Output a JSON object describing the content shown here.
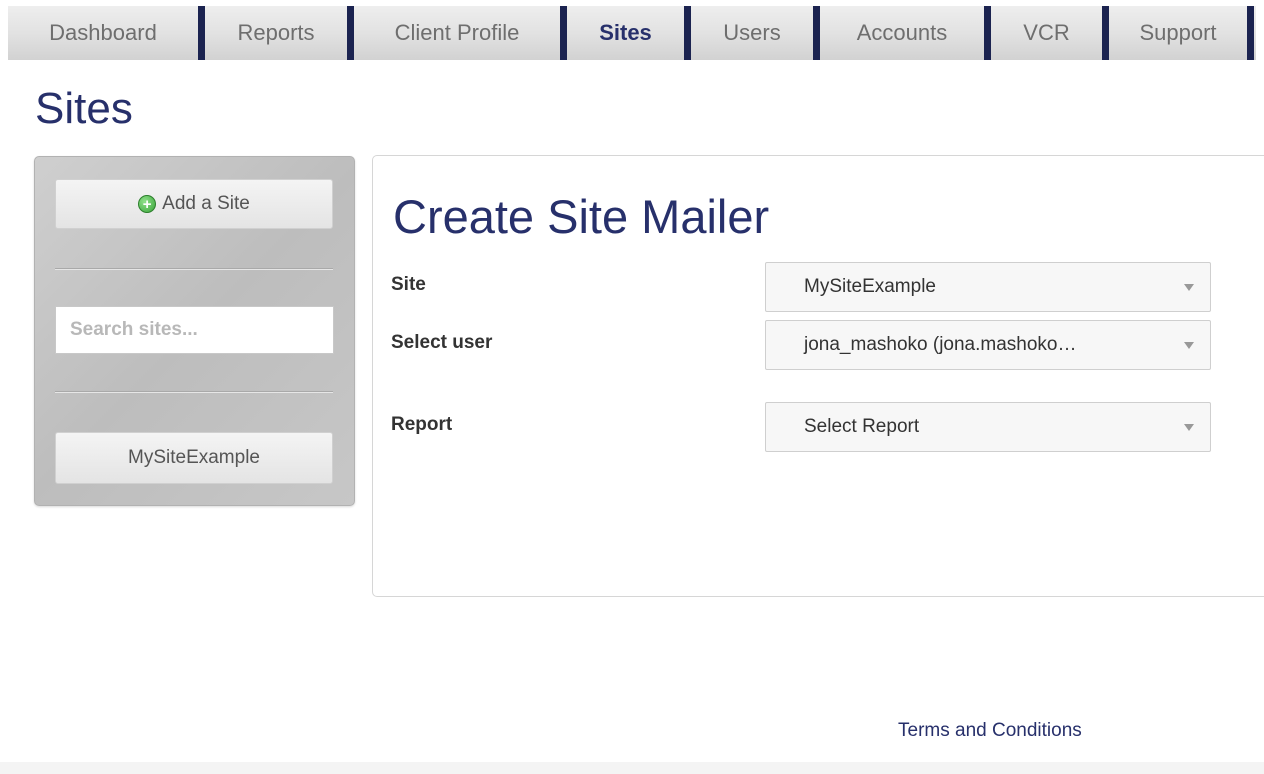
{
  "nav": {
    "items": [
      {
        "label": "Dashboard",
        "active": false
      },
      {
        "label": "Reports",
        "active": false
      },
      {
        "label": "Client Profile",
        "active": false
      },
      {
        "label": "Sites",
        "active": true
      },
      {
        "label": "Users",
        "active": false
      },
      {
        "label": "Accounts",
        "active": false
      },
      {
        "label": "VCR",
        "active": false
      },
      {
        "label": "Support",
        "active": false
      }
    ]
  },
  "page": {
    "title": "Sites"
  },
  "sidebar": {
    "add_label": "Add a Site",
    "search_placeholder": "Search sites...",
    "sites": [
      "MySiteExample"
    ]
  },
  "form": {
    "title": "Create Site Mailer",
    "site_label": "Site",
    "site_value": "MySiteExample",
    "user_label": "Select user",
    "user_value": "jona_mashoko (jona.mashoko…",
    "report_label": "Report",
    "report_value": "Select Report"
  },
  "footer": {
    "terms_label": "Terms and Conditions"
  },
  "colors": {
    "brand": "#27306b",
    "nav_separator": "#1b2350",
    "add_icon": "#3aa53a"
  }
}
